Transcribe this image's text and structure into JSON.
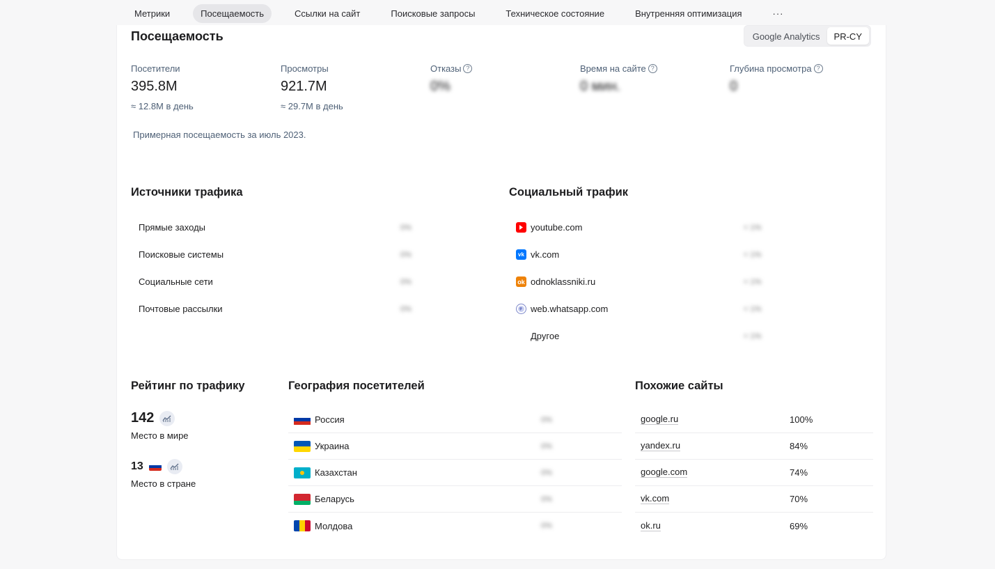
{
  "tabs": [
    "Метрики",
    "Посещаемость",
    "Ссылки на сайт",
    "Поисковые запросы",
    "Техническое состояние",
    "Внутренняя оптимизация",
    "···"
  ],
  "active_tab": 1,
  "page_title": "Посещаемость",
  "source_switch": {
    "options": [
      "Google Analytics",
      "PR-CY"
    ],
    "selected": "PR-CY"
  },
  "metrics": [
    {
      "label": "Посетители",
      "value": "395.8M",
      "sub": "≈ 12.8M в день",
      "blurred": false,
      "help": false
    },
    {
      "label": "Просмотры",
      "value": "921.7M",
      "sub": "≈ 29.7M в день",
      "blurred": false,
      "help": false
    },
    {
      "label": "Отказы",
      "value": "0%",
      "sub": "",
      "blurred": true,
      "help": true
    },
    {
      "label": "Время на сайте",
      "value": "0 мин.",
      "sub": "",
      "blurred": true,
      "help": true
    },
    {
      "label": "Глубина просмотра",
      "value": "0",
      "sub": "",
      "blurred": true,
      "help": true
    }
  ],
  "note": "Примерная посещаемость за июль 2023.",
  "traffic_sources": {
    "title": "Источники трафика",
    "rows": [
      {
        "label": "Прямые заходы",
        "value": "0%"
      },
      {
        "label": "Поисковые системы",
        "value": "0%"
      },
      {
        "label": "Социальные сети",
        "value": "0%"
      },
      {
        "label": "Почтовые рассылки",
        "value": "0%"
      }
    ]
  },
  "social_traffic": {
    "title": "Социальный трафик",
    "rows": [
      {
        "site": "youtube.com",
        "icon": "youtube-icon",
        "color": "#ff0000",
        "value": "< 1%"
      },
      {
        "site": "vk.com",
        "icon": "vk-icon",
        "color": "#0077ff",
        "value": "< 1%"
      },
      {
        "site": "odnoklassniki.ru",
        "icon": "odnoklassniki-icon",
        "color": "#ee8208",
        "value": "< 1%"
      },
      {
        "site": "web.whatsapp.com",
        "icon": "globe-icon",
        "color": "#7b86c9",
        "value": "< 1%"
      },
      {
        "site": "Другое",
        "icon": "",
        "color": "",
        "value": "< 1%"
      }
    ]
  },
  "rating": {
    "title": "Рейтинг по трафику",
    "world_rank": "142",
    "world_caption": "Место в мире",
    "country_rank": "13",
    "country_caption": "Место в стране"
  },
  "geography": {
    "title": "География посетителей",
    "rows": [
      {
        "country": "Россия",
        "flag": [
          "#ffffff",
          "#0039a6",
          "#d52b1e"
        ],
        "value": "0%"
      },
      {
        "country": "Украина",
        "flag": [
          "#0057b7",
          "#ffd700"
        ],
        "value": "0%"
      },
      {
        "country": "Казахстан",
        "flag": [
          "#00afca"
        ],
        "value": "0%"
      },
      {
        "country": "Беларусь",
        "flag": [
          "#d22730",
          "#d22730",
          "#00af66"
        ],
        "value": "0%"
      },
      {
        "country": "Молдова",
        "flag": [
          "#0046ae",
          "#ffd200",
          "#cc092f"
        ],
        "value": "0%"
      }
    ]
  },
  "similar_sites": {
    "title": "Похожие сайты",
    "rows": [
      {
        "site": "google.ru",
        "pct": "100%"
      },
      {
        "site": "yandex.ru",
        "pct": "84%"
      },
      {
        "site": "google.com",
        "pct": "74%"
      },
      {
        "site": "vk.com",
        "pct": "70%"
      },
      {
        "site": "ok.ru",
        "pct": "69%"
      }
    ]
  }
}
